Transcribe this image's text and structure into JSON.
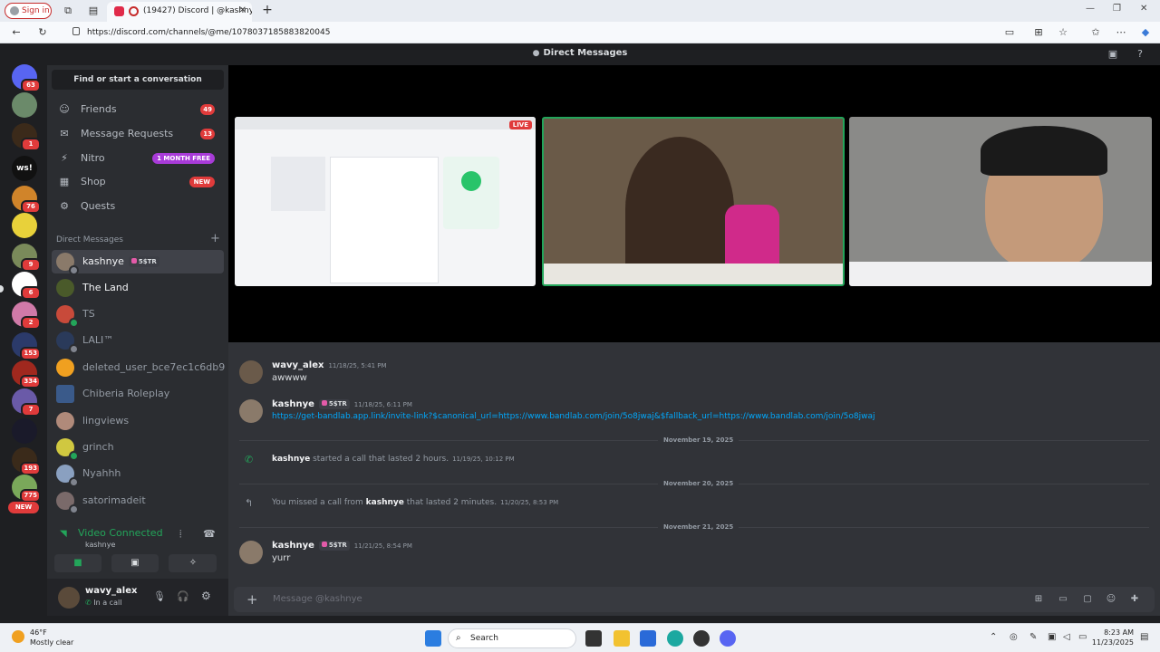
{
  "browser": {
    "signin_label": "Sign in",
    "tab_title": "(19427) Discord | @kashnye",
    "url": "https://discord.com/channels/@me/1078037185883820045"
  },
  "app": {
    "title": "Direct Messages"
  },
  "rail": {
    "badges": [
      "63",
      "1",
      "76",
      "9",
      "6",
      "2",
      "153",
      "334",
      "7",
      "193",
      "775"
    ],
    "ws_label": "ws!",
    "new_label": "NEW"
  },
  "sidebar": {
    "find_label": "Find or start a conversation",
    "nav": [
      {
        "label": "Friends",
        "count": "49"
      },
      {
        "label": "Message Requests",
        "count": "13"
      },
      {
        "label": "Nitro",
        "pill": "1 MONTH FREE"
      },
      {
        "label": "Shop",
        "pill": "NEW"
      },
      {
        "label": "Quests"
      }
    ],
    "dm_header": "Direct Messages",
    "dms": [
      {
        "name": "kashnye",
        "tag": "5$TR"
      },
      {
        "name": "The Land"
      },
      {
        "name": "TS"
      },
      {
        "name": "LALI™"
      },
      {
        "name": "deleted_user_bce7ec1c6db9"
      },
      {
        "name": "Chiberia Roleplay"
      },
      {
        "name": "lingviews"
      },
      {
        "name": "grinch"
      },
      {
        "name": "Nyahhh"
      },
      {
        "name": "satorimadeit"
      }
    ],
    "voice": {
      "title": "Video Connected",
      "sub": "kashnye"
    },
    "user": {
      "name": "wavy_alex",
      "status": "In a call"
    }
  },
  "stage": {
    "live_label": "LIVE"
  },
  "chat": {
    "messages": [
      {
        "author": "wavy_alex",
        "time": "11/18/25, 5:41 PM",
        "text": "awwww"
      },
      {
        "author": "kashnye",
        "tag": "5$TR",
        "time": "11/18/25, 6:11 PM",
        "text": "https://get-bandlab.app.link/invite-link?$canonical_url=https://www.bandlab.com/join/5o8jwaj&$fallback_url=https://www.bandlab.com/join/5o8jwaj"
      },
      {
        "divider": "November 19, 2025"
      },
      {
        "system_user": "kashnye",
        "system_text": "started a call that lasted 2 hours.",
        "time": "11/19/25, 10:12 PM"
      },
      {
        "divider": "November 20, 2025"
      },
      {
        "system_prefix": "You missed a call from",
        "system_user": "kashnye",
        "system_text": "that lasted 2 minutes.",
        "time": "11/20/25, 8:53 PM"
      },
      {
        "divider": "November 21, 2025"
      },
      {
        "author": "kashnye",
        "tag": "5$TR",
        "time": "11/21/25, 8:54 PM",
        "text": "yurr"
      }
    ],
    "placeholder": "Message @kashnye"
  },
  "taskbar": {
    "temp": "46°F",
    "weather": "Mostly clear",
    "search": "Search",
    "time": "8:23 AM",
    "date": "11/23/2025"
  }
}
